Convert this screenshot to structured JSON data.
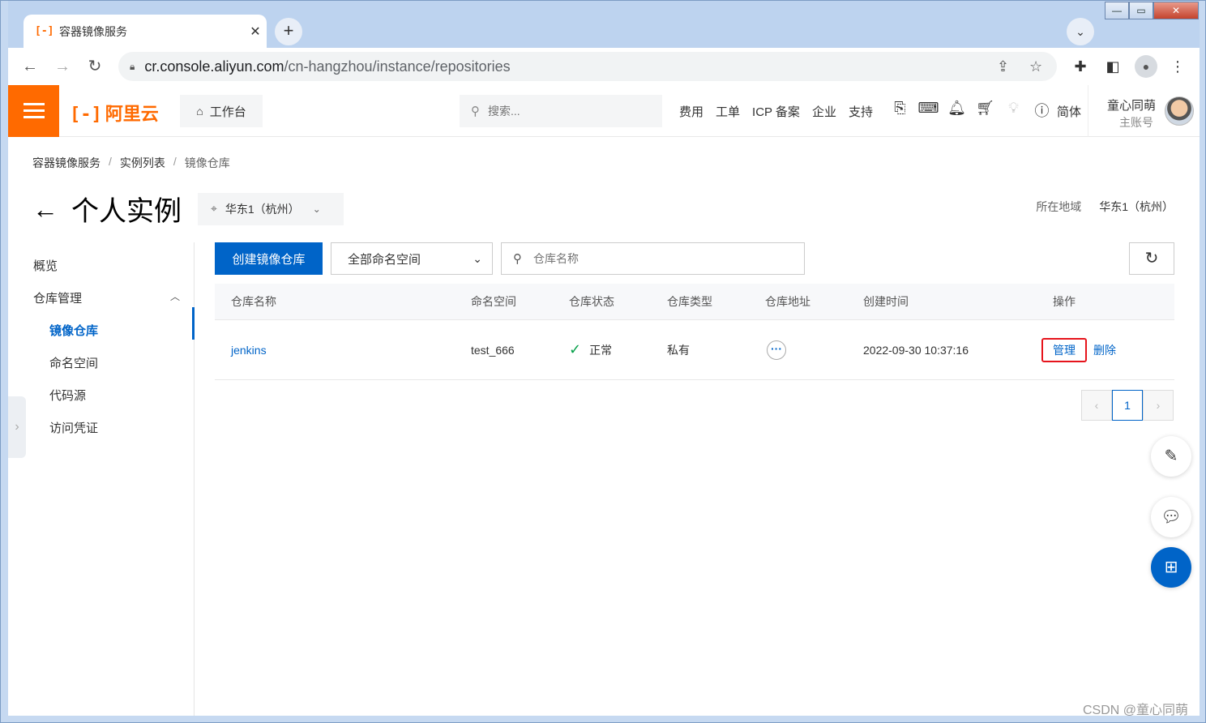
{
  "browser": {
    "tab_title": "容器镜像服务",
    "tab_logo": "[-]",
    "url_host": "cr.console.aliyun.com",
    "url_path": "/cn-hangzhou/instance/repositories"
  },
  "topbar": {
    "brand": "阿里云",
    "brand_mark": "[-]",
    "workbench": "工作台",
    "search_placeholder": "搜索...",
    "links": [
      "费用",
      "工单",
      "ICP 备案",
      "企业",
      "支持"
    ],
    "lang": "简体",
    "user_name": "童心同萌",
    "user_sub": "主账号"
  },
  "breadcrumb": [
    "容器镜像服务",
    "实例列表",
    "镜像仓库"
  ],
  "page": {
    "title": "个人实例",
    "region_selector": "华东1（杭州）",
    "region_label": "所在地域",
    "region_value": "华东1（杭州）"
  },
  "sidenav": {
    "overview": "概览",
    "repo_mgmt": "仓库管理",
    "items": [
      "镜像仓库",
      "命名空间",
      "代码源",
      "访问凭证"
    ]
  },
  "toolbar": {
    "create_button": "创建镜像仓库",
    "namespace_select": "全部命名空间",
    "search_placeholder": "仓库名称"
  },
  "table": {
    "headers": [
      "仓库名称",
      "命名空间",
      "仓库状态",
      "仓库类型",
      "仓库地址",
      "创建时间",
      "操作"
    ],
    "rows": [
      {
        "name": "jenkins",
        "namespace": "test_666",
        "status": "正常",
        "type": "私有",
        "created": "2022-09-30 10:37:16",
        "action_manage": "管理",
        "action_delete": "删除"
      }
    ]
  },
  "pagination": {
    "current": "1"
  },
  "watermark": "CSDN @童心同萌",
  "colors": {
    "accent": "#0064c8",
    "brand": "#ff6a00",
    "highlight": "#e6141c",
    "success": "#06a04a"
  }
}
